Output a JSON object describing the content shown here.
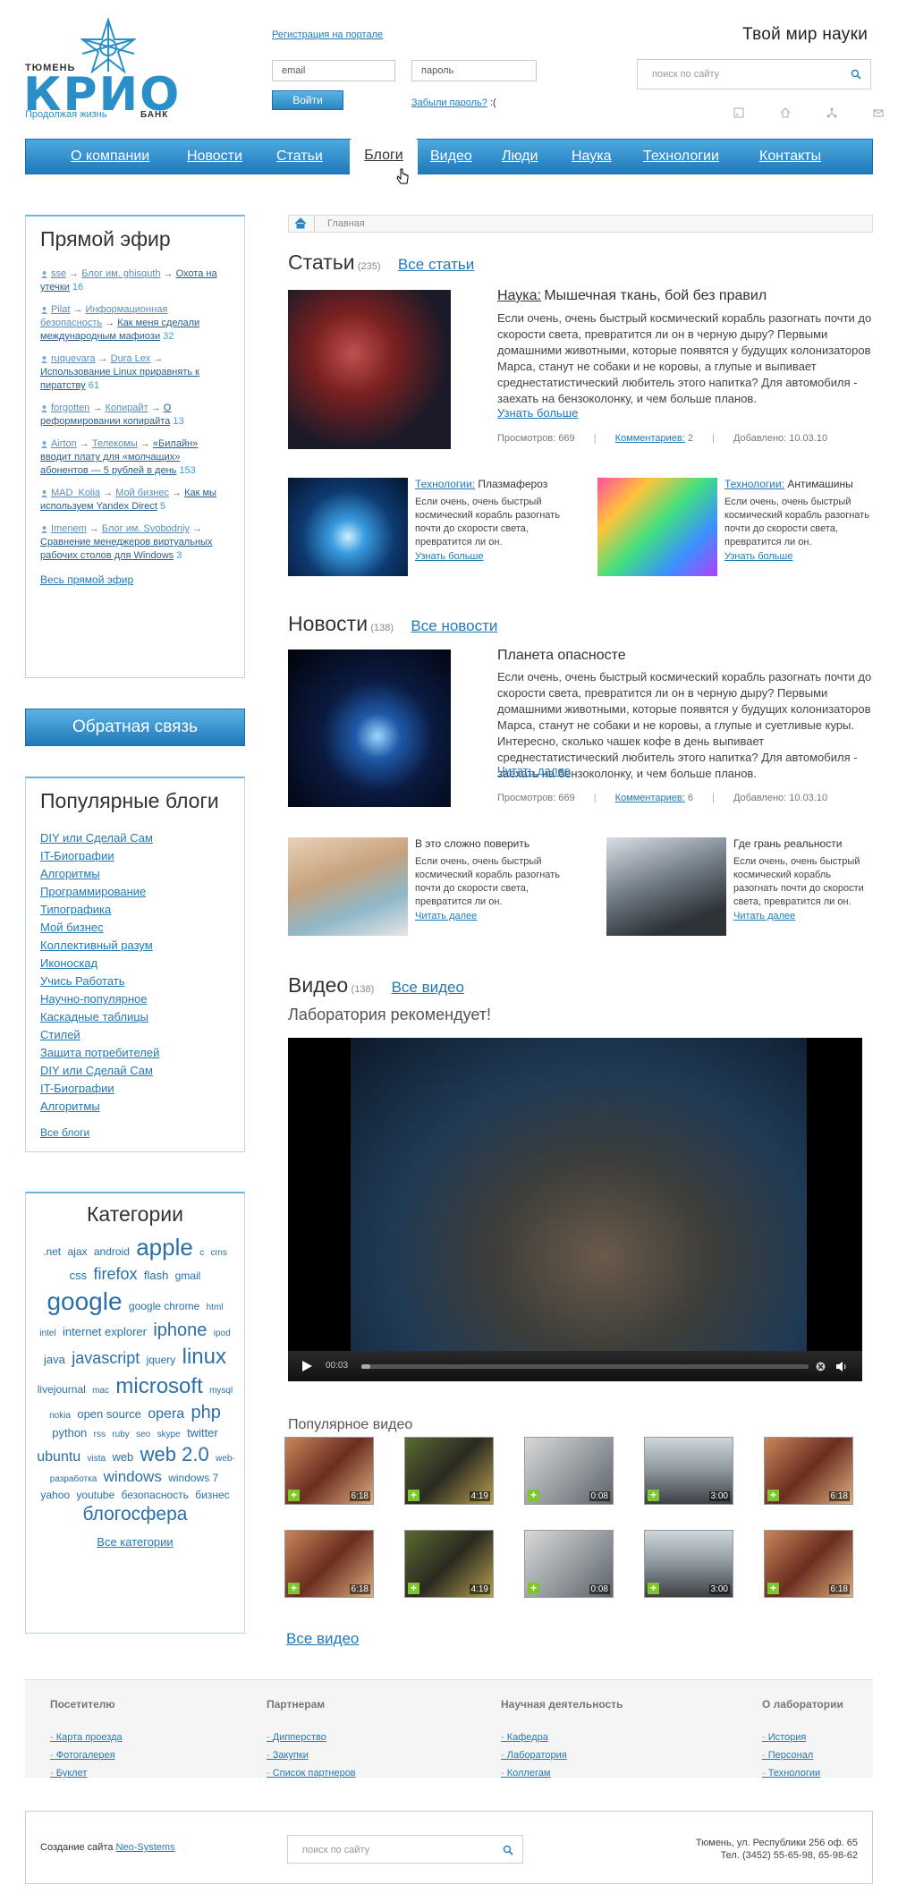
{
  "header": {
    "logo_city": "ТЮМЕНЬ",
    "logo_word": "КРИО",
    "logo_slogan": "Продолжая жизнь",
    "logo_bank": "БАНК",
    "register_link": "Регистрация на портале",
    "email_placeholder": "email",
    "password_placeholder": "пароль",
    "login_button": "Войти",
    "forgot_link": "Забыли пароль?",
    "forgot_suffix": ":(",
    "tagline": "Твой мир науки",
    "search_placeholder": "поиск по сайту"
  },
  "nav": {
    "items": [
      "О компании",
      "Новости",
      "Статьи",
      "Блоги",
      "Видео",
      "Люди",
      "Наука",
      "Технологии",
      "Контакты"
    ],
    "active": "Блоги"
  },
  "live": {
    "title": "Прямой эфир",
    "items": [
      {
        "user": "sse",
        "blog": "Блог им. ghisquth",
        "post": "Охота на утечки",
        "count": "16"
      },
      {
        "user": "Pilat",
        "blog": "Информационная безопасность",
        "post": "Как меня сделали международным мафиози",
        "count": "32"
      },
      {
        "user": "ruquevara",
        "blog": "Dura Lex",
        "post": "Использование Linux приравнять к пиратству",
        "count": "61"
      },
      {
        "user": "forgotten",
        "blog": "Копирайт",
        "post": "О реформировании копирайта",
        "count": "13"
      },
      {
        "user": "Airton",
        "blog": "Телекомы",
        "post": "«Билайн» вводит плату для «молчащих» абонентов — 5 рублей в день",
        "count": "153"
      },
      {
        "user": "MAD_Kolia",
        "blog": "Мой бизнес",
        "post": "Как мы используем Yandex Direct",
        "count": "5"
      },
      {
        "user": "Imenem",
        "blog": "Блог им. Svobodniy",
        "post": "Сравнение менеджеров виртуальных рабочих столов для Windows",
        "count": "3"
      }
    ],
    "all_link": "Весь прямой эфир"
  },
  "feedback_button": "Обратная связь",
  "popular_blogs": {
    "title": "Популярные блоги",
    "items": [
      "DIY или Сделай Сам",
      "IT-Биографии",
      "Алгоритмы",
      "Программирование",
      "Типографика",
      "Мой бизнес",
      "Коллективный разум",
      "Иконоскад",
      "Учись Работать",
      "Научно-популярное",
      "Каскадные таблицы",
      "Стилей",
      "Защита потребителей",
      "DIY или Сделай Сам",
      "IT-Биографии",
      "Алгоритмы"
    ],
    "all_link": "Все блоги"
  },
  "categories": {
    "title": "Категории",
    "tags": [
      {
        "t": ".net",
        "s": 12
      },
      {
        "t": "ajax",
        "s": 12
      },
      {
        "t": "android",
        "s": 12
      },
      {
        "t": "apple",
        "s": 26
      },
      {
        "t": "c",
        "s": 10
      },
      {
        "t": "cms",
        "s": 10
      },
      {
        "t": "css",
        "s": 13
      },
      {
        "t": "firefox",
        "s": 18
      },
      {
        "t": "flash",
        "s": 13
      },
      {
        "t": "gmail",
        "s": 12
      },
      {
        "t": "google",
        "s": 28
      },
      {
        "t": "google chrome",
        "s": 12
      },
      {
        "t": "html",
        "s": 10
      },
      {
        "t": "intel",
        "s": 10
      },
      {
        "t": "internet explorer",
        "s": 13
      },
      {
        "t": "iphone",
        "s": 20
      },
      {
        "t": "ipod",
        "s": 10
      },
      {
        "t": "java",
        "s": 13
      },
      {
        "t": "javascript",
        "s": 18
      },
      {
        "t": "jquery",
        "s": 12
      },
      {
        "t": "linux",
        "s": 24
      },
      {
        "t": "livejournal",
        "s": 12
      },
      {
        "t": "mac",
        "s": 10
      },
      {
        "t": "microsoft",
        "s": 24
      },
      {
        "t": "mysql",
        "s": 10
      },
      {
        "t": "nokia",
        "s": 10
      },
      {
        "t": "open source",
        "s": 13
      },
      {
        "t": "opera",
        "s": 16
      },
      {
        "t": "php",
        "s": 20
      },
      {
        "t": "python",
        "s": 13
      },
      {
        "t": "rss",
        "s": 10
      },
      {
        "t": "ruby",
        "s": 10
      },
      {
        "t": "seo",
        "s": 10
      },
      {
        "t": "skype",
        "s": 10
      },
      {
        "t": "twitter",
        "s": 13
      },
      {
        "t": "ubuntu",
        "s": 16
      },
      {
        "t": "vista",
        "s": 10
      },
      {
        "t": "web",
        "s": 13
      },
      {
        "t": "web 2.0",
        "s": 22
      },
      {
        "t": "web-разработка",
        "s": 10
      },
      {
        "t": "windows",
        "s": 17
      },
      {
        "t": "windows 7",
        "s": 12
      },
      {
        "t": "yahoo",
        "s": 12
      },
      {
        "t": "youtube",
        "s": 12
      },
      {
        "t": "безопасность",
        "s": 12
      },
      {
        "t": "бизнес",
        "s": 12
      },
      {
        "t": "блогосфера",
        "s": 21
      }
    ],
    "all_link": "Все категории"
  },
  "breadcrumb": {
    "home": "Главная"
  },
  "articles": {
    "title": "Статьи",
    "count": "(235)",
    "all_link": "Все статьи",
    "main": {
      "category": "Наука:",
      "title": "Мышечная ткань, бой без правил",
      "text": "Если очень, очень быстрый космический корабль разогнать почти до скорости света, превратится ли он в черную дыру? Первыми домашними животными, которые появятся у будущих колонизаторов Марса, станут не собаки и не коровы, а глупые и выпивает среднестатистический любитель этого напитка? Для автомобиля - заехать на бензоколонку, и чем больше планов.",
      "more": "Узнать больше",
      "views": "Просмотров: 669",
      "comments_label": "Комментариев:",
      "comments": "2",
      "added": "Добавлено: 10.03.10"
    },
    "small": [
      {
        "category": "Технологии:",
        "title": "Плазмафероз",
        "text": "Если очень, очень быстрый космический корабль разогнать почти до скорости света, превратится ли он.",
        "more": "Узнать больше"
      },
      {
        "category": "Технологии:",
        "title": "Антимашины",
        "text": "Если очень, очень быстрый космический корабль разогнать почти до скорости света, превратится ли он.",
        "more": "Узнать больше"
      }
    ]
  },
  "news": {
    "title": "Новости",
    "count": "(138)",
    "all_link": "Все новости",
    "main": {
      "title": "Планета опасносте",
      "text": "Если очень, очень быстрый космический корабль разогнать почти до скорости света, превратится ли он в черную дыру? Первыми домашними животными, которые появятся у будущих колонизаторов Марса, станут не собаки и не коровы, а глупые и суетливые куры. Интересно, сколько чашек кофе в день выпивает среднестатистический любитель этого напитка? Для автомобиля - заехать на бензоколонку, и чем больше планов.",
      "more": "Читать далее",
      "views": "Просмотров: 669",
      "comments_label": "Комментариев:",
      "comments": "6",
      "added": "Добавлено: 10.03.10"
    },
    "small": [
      {
        "title": "В это сложно поверить",
        "text": "Если очень, очень быстрый космический корабль разогнать почти до скорости света, превратится ли он.",
        "more": "Читать далее"
      },
      {
        "title": "Где грань реальности",
        "text": "Если очень, очень быстрый космический корабль разогнать почти до скорости света, превратится ли он.",
        "more": "Читать далее"
      }
    ]
  },
  "video": {
    "title": "Видео",
    "count": "(138)",
    "all_link": "Все видео",
    "subtitle": "Лаборатория рекомендует!",
    "player_time": "00:03",
    "played_fraction": 0.02,
    "popular_title": "Популярное видео",
    "thumbs": [
      "6:18",
      "4:19",
      "0:08",
      "3:00",
      "6:18",
      "6:18",
      "4:19",
      "0:08",
      "3:00",
      "6:18"
    ],
    "bottom_all_link": "Все видео"
  },
  "footer": {
    "cols": [
      {
        "head": "Посетителю",
        "links": [
          "Карта проезда",
          "Фотогалерея",
          "Буклет"
        ]
      },
      {
        "head": "Партнерам",
        "links": [
          "Дипперство",
          "Закупки",
          "Список партнеров"
        ]
      },
      {
        "head": "Научная деятельность",
        "links": [
          "Кафедра",
          "Лаборатория",
          "Коллегам"
        ]
      },
      {
        "head": "О лаборатории",
        "links": [
          "История",
          "Персонал",
          "Технологии"
        ]
      }
    ],
    "creation_text": "Создание сайта",
    "creation_link": "Neo-Systems",
    "search_placeholder": "поиск по сайту",
    "address": "Тюмень, ул. Республики 256 оф. 65",
    "phone": "Тел. (3452) 55-65-98, 65-98-62"
  }
}
